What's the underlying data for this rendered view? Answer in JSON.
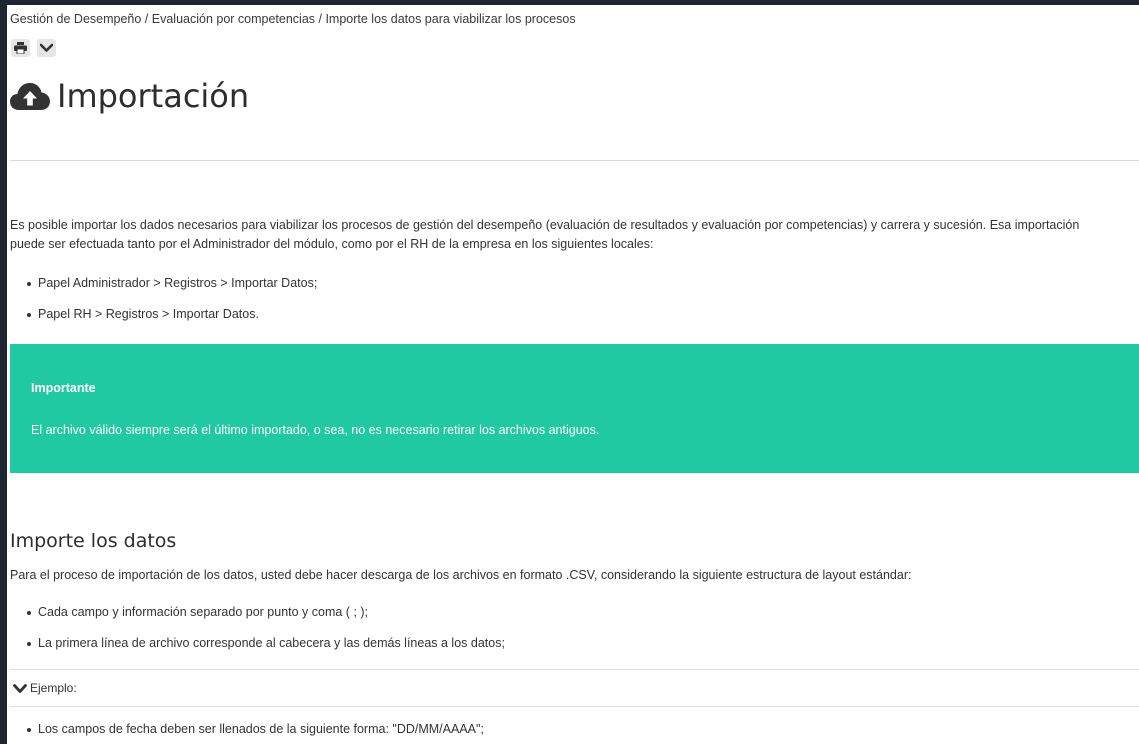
{
  "breadcrumb": "Gestión de Desempeño / Evaluación por competencias / Importe los datos para viabilizar los procesos",
  "toolbar": {
    "print_icon": "print-icon",
    "expand_icon": "chevron-down-icon"
  },
  "page": {
    "title_icon": "cloud-upload-icon",
    "title": "Importación"
  },
  "intro": {
    "paragraph": "Es posible importar los dados necesarios para viabilizar los procesos de gestión del desempeño (evaluación de resultados y evaluación por competencias) y carrera y sucesión. Esa importación puede ser efectuada tanto por el Administrador del módulo, como por el RH de la empresa en los siguientes locales:",
    "bullets": [
      "Papel Administrador > Registros > Importar Datos;",
      "Papel RH > Registros > Importar Datos."
    ]
  },
  "callout": {
    "title": "Importante",
    "text": "El archivo válido siempre será el último importado, o sea, no es necesario retirar los archivos antiguos.",
    "background": "#20c9a1"
  },
  "import_section": {
    "heading": "Importe los datos",
    "paragraph": "Para el proceso de importación de los datos, usted debe hacer descarga de los archivos en formato .CSV, considerando la siguiente estructura de layout estándar:",
    "bullets": [
      "Cada campo y información separado por punto y coma ( ; );",
      "La primera línea de archivo corresponde al cabecera y las demás líneas a los datos;"
    ],
    "expander_label": "Ejemplo:",
    "expander_icon": "chevron-down-icon",
    "bullets_after": [
      "Los campos de fecha deben ser llenados de la siguiente forma: \"DD/MM/AAAA\";"
    ]
  }
}
